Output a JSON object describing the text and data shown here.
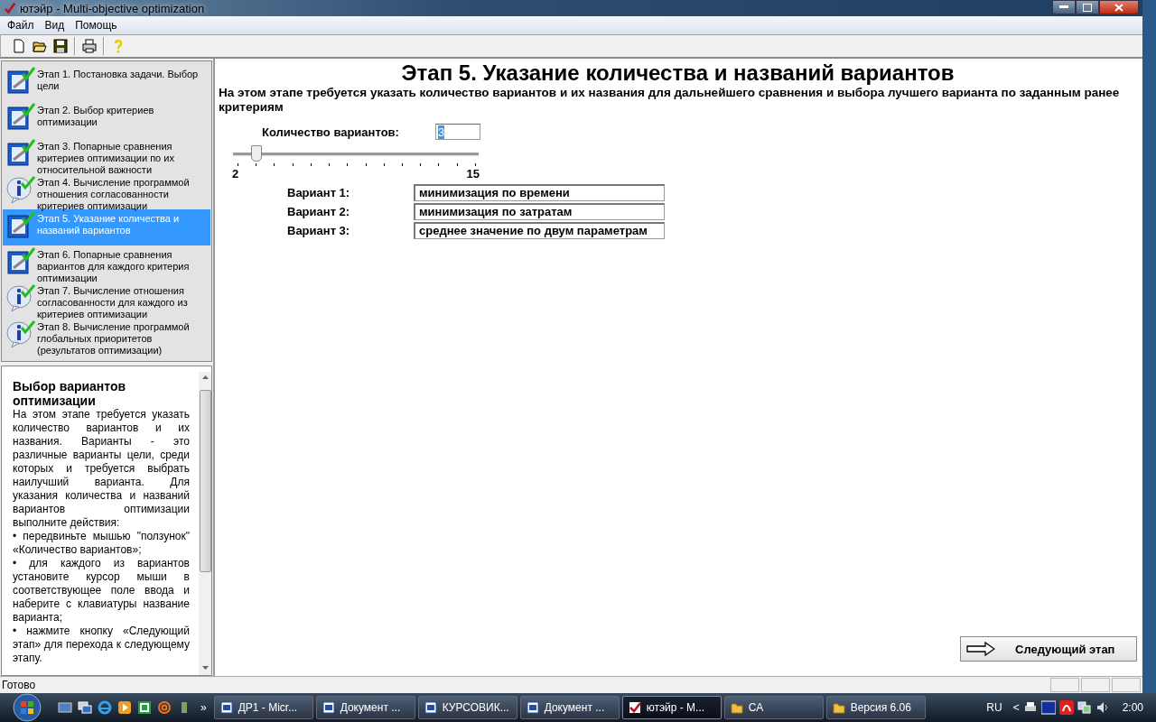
{
  "window": {
    "title": "ютэйр - Multi-objective optimization"
  },
  "menu": [
    "Файл",
    "Вид",
    "Помощь"
  ],
  "toolbar": [
    {
      "kind": "new"
    },
    {
      "kind": "open"
    },
    {
      "kind": "save"
    },
    {
      "kind": "sep"
    },
    {
      "kind": "print"
    },
    {
      "kind": "sep"
    },
    {
      "kind": "help"
    }
  ],
  "steps": [
    {
      "kind": "edit",
      "label": "Этап 1. Постановка задачи. Выбор цели",
      "selected": false
    },
    {
      "kind": "edit",
      "label": "Этап 2. Выбор критериев оптимизации",
      "selected": false
    },
    {
      "kind": "edit",
      "label": "Этап 3. Попарные сравнения критериев оптимизации по их относительной важности",
      "selected": false
    },
    {
      "kind": "info",
      "label": "Этап 4. Вычисление программой отношения согласованности критериев оптимизации",
      "selected": false
    },
    {
      "kind": "edit",
      "label": "Этап 5. Указание количества и названий вариантов",
      "selected": true
    },
    {
      "kind": "edit",
      "label": "Этап 6. Попарные сравнения вариантов для каждого критерия оптимизации",
      "selected": false
    },
    {
      "kind": "info",
      "label": "Этап 7. Вычисление отношения согласованности для каждого из критериев оптимизации",
      "selected": false
    },
    {
      "kind": "info",
      "label": "Этап 8. Вычисление программой глобальных приоритетов (результатов оптимизации)",
      "selected": false
    }
  ],
  "help": {
    "title": "Выбор вариантов оптимизации",
    "paragraphs": [
      "На этом этапе требуется указать количество вариантов и их названия. Варианты - это различные варианты цели, среди которых и требуется выбрать наилучший варианта. Для указания количества и названий вариантов оптимизации выполните действия:",
      "• передвиньте мышью \"ползунок\" «Количество вариантов»;",
      "• для каждого из вариантов установите курсор мыши в соответствующее поле ввода и наберите с клавиатуры название варианта;",
      "• нажмите кнопку «Следующий этап» для перехода к следующему этапу."
    ]
  },
  "main": {
    "heading": "Этап 5. Указание количества и названий вариантов",
    "description": "На этом этапе требуется указать количество вариантов и их названия для дальнейшего сравнения и выбора лучшего варианта по заданным ранее критериям",
    "count_label": "Количество вариантов:",
    "count_value": "3",
    "slider": {
      "level": 0.077,
      "min_label": "2",
      "max_label": "15"
    },
    "variants": [
      {
        "label": "Вариант 1:",
        "value": "минимизация по времени"
      },
      {
        "label": "Вариант 2:",
        "value": "минимизация по затратам"
      },
      {
        "label": "Вариант 3:",
        "value": "среднее значение по двум параметрам"
      }
    ],
    "next_button": "Следующий этап"
  },
  "status_bar": {
    "text": "Готово"
  },
  "taskbar": {
    "overflow": "»",
    "buttons": [
      {
        "label": "ДР1 - Micr...",
        "kind": "word",
        "selected": false
      },
      {
        "label": "Документ ...",
        "kind": "word",
        "selected": false
      },
      {
        "label": "КУРСОВИК...",
        "kind": "word",
        "selected": false
      },
      {
        "label": "Документ ...",
        "kind": "word",
        "selected": false
      },
      {
        "label": "ютэйр - M...",
        "kind": "app",
        "selected": true
      },
      {
        "label": "CA",
        "kind": "folder",
        "selected": false
      },
      {
        "label": "Версия 6.06",
        "kind": "folder",
        "selected": false
      }
    ],
    "language": "RU",
    "tray_arrow": "<",
    "clock": "2:00"
  }
}
